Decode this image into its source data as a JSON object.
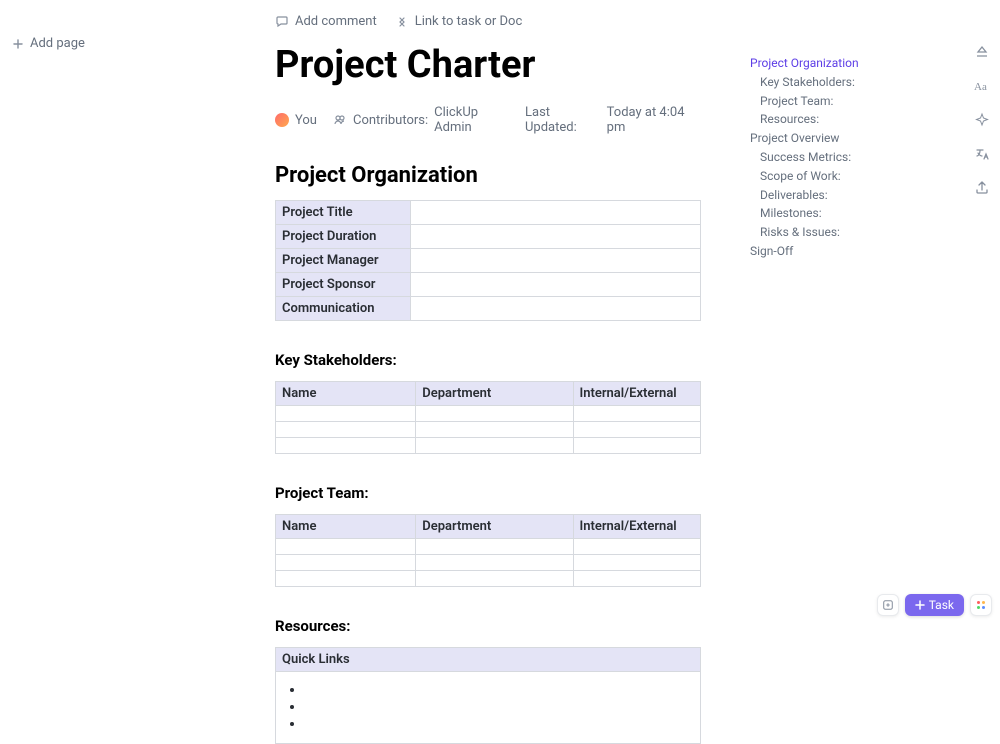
{
  "sidebar": {
    "add_page": "Add page"
  },
  "toolbar": {
    "add_comment": "Add comment",
    "link": "Link to task or Doc"
  },
  "doc": {
    "title": "Project Charter"
  },
  "meta": {
    "owner": "You",
    "contributors_label": "Contributors:",
    "contributors": "ClickUp Admin",
    "updated_label": "Last Updated:",
    "updated": "Today at 4:04 pm"
  },
  "section1": {
    "heading": "Project Organization",
    "rows": [
      "Project Title",
      "Project Duration",
      "Project Manager",
      "Project Sponsor",
      "Communication"
    ]
  },
  "section2": {
    "heading": "Key Stakeholders:",
    "headers": [
      "Name",
      "Department",
      "Internal/External"
    ]
  },
  "section3": {
    "heading": "Project Team:",
    "headers": [
      "Name",
      "Department",
      "Internal/External"
    ]
  },
  "section4": {
    "heading": "Resources:",
    "row_header": "Quick Links"
  },
  "outline": {
    "items": [
      {
        "label": "Project Organization",
        "level": 0,
        "active": true
      },
      {
        "label": "Key Stakeholders:",
        "level": 1,
        "active": false
      },
      {
        "label": "Project Team:",
        "level": 1,
        "active": false
      },
      {
        "label": "Resources:",
        "level": 1,
        "active": false
      },
      {
        "label": "Project Overview",
        "level": 0,
        "active": false
      },
      {
        "label": "Success Metrics:",
        "level": 1,
        "active": false
      },
      {
        "label": "Scope of Work:",
        "level": 1,
        "active": false
      },
      {
        "label": "Deliverables:",
        "level": 1,
        "active": false
      },
      {
        "label": "Milestones:",
        "level": 1,
        "active": false
      },
      {
        "label": "Risks & Issues:",
        "level": 1,
        "active": false
      },
      {
        "label": "Sign-Off",
        "level": 0,
        "active": false
      }
    ]
  },
  "task_btn": "Task"
}
